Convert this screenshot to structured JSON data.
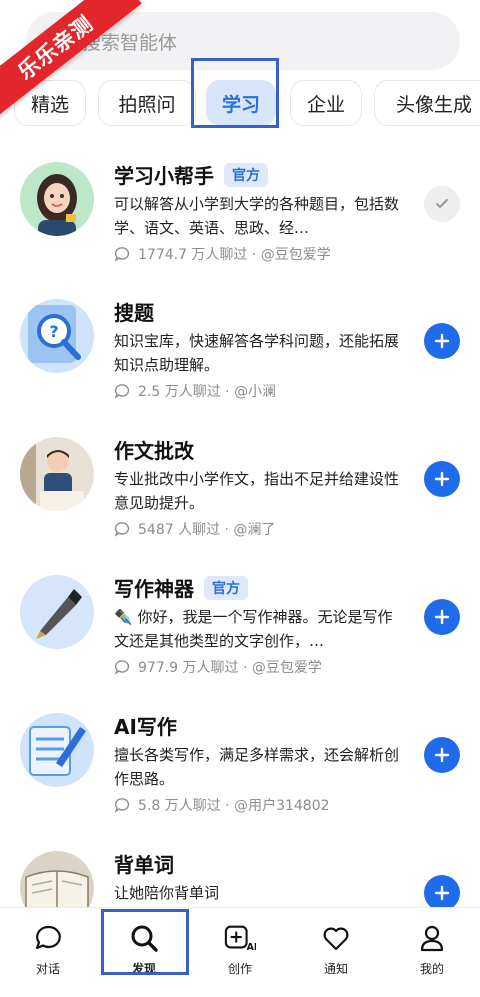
{
  "watermark": "乐乐亲测",
  "search": {
    "placeholder": "搜索智能体",
    "icon": "search-icon"
  },
  "tabs": [
    {
      "label": "精选",
      "active": false
    },
    {
      "label": "拍照问",
      "active": false
    },
    {
      "label": "学习",
      "active": true
    },
    {
      "label": "企业",
      "active": false
    },
    {
      "label": "头像生成",
      "active": false
    }
  ],
  "agents": [
    {
      "name": "学习小帮手",
      "badge": "官方",
      "desc": "可以解答从小学到大学的各种题目，包括数学、语文、英语、思政、经…",
      "meta": "1774.7 万人聊过 · @豆包爱学",
      "added": true,
      "avatar": "girl-tutor-avatar"
    },
    {
      "name": "搜题",
      "badge": "",
      "desc": "知识宝库，快速解答各学科问题，还能拓展知识点助理解。",
      "meta": "2.5 万人聊过 · @小澜",
      "added": false,
      "avatar": "magnifier-question-avatar"
    },
    {
      "name": "作文批改",
      "badge": "",
      "desc": "专业批改中小学作文，指出不足并给建设性意见助提升。",
      "meta": "5487 人聊过 · @澜了",
      "added": false,
      "avatar": "teacher-avatar"
    },
    {
      "name": "写作神器",
      "badge": "官方",
      "desc": "✒️ 你好，我是一个写作神器。无论是写作文还是其他类型的文字创作，…",
      "meta": "977.9 万人聊过 · @豆包爱学",
      "added": false,
      "avatar": "fountain-pen-avatar"
    },
    {
      "name": "AI写作",
      "badge": "",
      "desc": "擅长各类写作，满足多样需求，还会解析创作思路。",
      "meta": "5.8 万人聊过 · @用户314802",
      "added": false,
      "avatar": "pen-paper-avatar"
    },
    {
      "name": "背单词",
      "badge": "",
      "desc": "让她陪你背单词",
      "meta": "",
      "added": false,
      "avatar": "book-avatar"
    }
  ],
  "bottom_nav": [
    {
      "label": "对话",
      "icon": "chat-bubble-icon",
      "active": false
    },
    {
      "label": "发现",
      "icon": "search-icon",
      "active": true
    },
    {
      "label": "创作",
      "icon": "create-ai-icon",
      "active": false
    },
    {
      "label": "通知",
      "icon": "heart-icon",
      "active": false
    },
    {
      "label": "我的",
      "icon": "profile-icon",
      "active": false
    }
  ],
  "colors": {
    "accent": "#1f6bea",
    "badge_bg": "#dfe9fb",
    "watermark": "#e3262b",
    "focus_box": "#3b5fc9"
  }
}
